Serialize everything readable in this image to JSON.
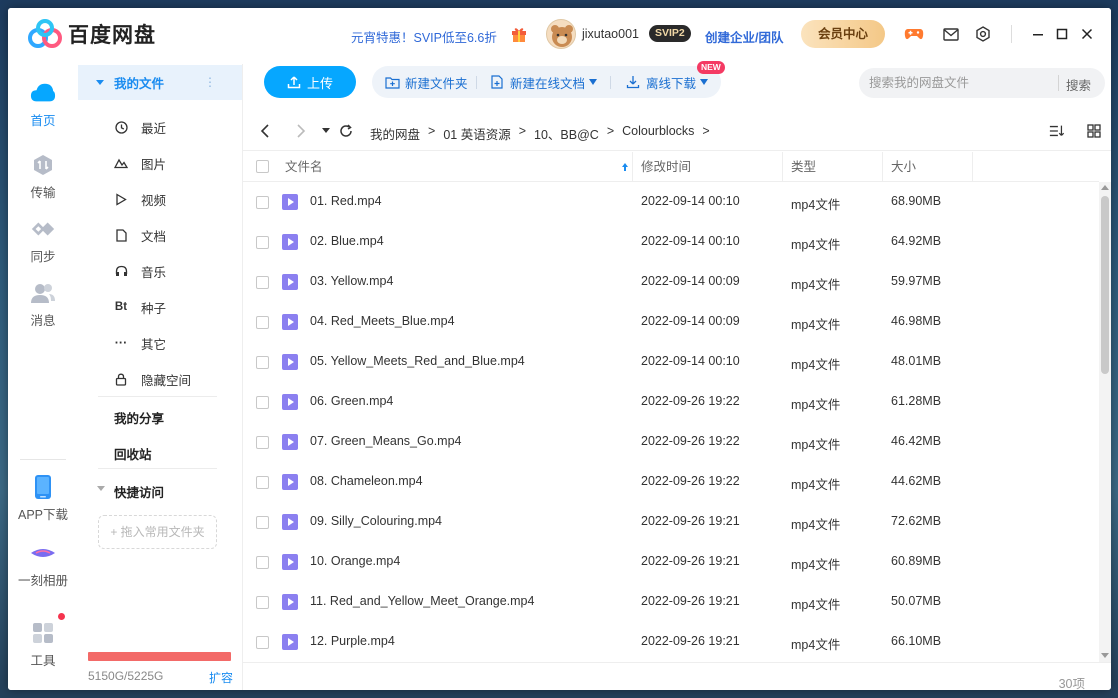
{
  "app": {
    "name": "百度网盘",
    "promo": "元宵特惠！SVIP低至6.6折",
    "username": "jixutao001",
    "badge": "SVIP2",
    "enterprise": "创建企业/团队",
    "vip_center": "会员中心"
  },
  "rail": {
    "home": "首页",
    "transfer": "传输",
    "sync": "同步",
    "messages": "消息",
    "app_download": "APP下载",
    "album": "一刻相册",
    "tools": "工具"
  },
  "sidebar": {
    "my_files": "我的文件",
    "items": [
      {
        "label": "最近",
        "icon": "clock-icon"
      },
      {
        "label": "图片",
        "icon": "image-icon"
      },
      {
        "label": "视频",
        "icon": "video-icon"
      },
      {
        "label": "文档",
        "icon": "document-icon"
      },
      {
        "label": "音乐",
        "icon": "headphones-icon"
      },
      {
        "label": "种子",
        "icon": "bt-icon"
      },
      {
        "label": "其它",
        "icon": "more-icon"
      },
      {
        "label": "隐藏空间",
        "icon": "lock-icon"
      }
    ],
    "my_share": "我的分享",
    "recycle": "回收站",
    "quick_access": "快捷访问",
    "drag_hint": "+ 拖入常用文件夹",
    "storage": "5150G/5225G",
    "storage_used_fraction": 0.9856,
    "expand": "扩容"
  },
  "toolbar": {
    "upload": "上传",
    "new_folder": "新建文件夹",
    "new_doc": "新建在线文档",
    "new_badge": "NEW",
    "offline": "离线下载",
    "search_placeholder": "搜索我的网盘文件",
    "search_button": "搜索"
  },
  "breadcrumb": [
    "我的网盘",
    "01 英语资源",
    "10、BB@C",
    "Colourblocks"
  ],
  "columns": {
    "name": "文件名",
    "modified": "修改时间",
    "type": "类型",
    "size": "大小"
  },
  "files": [
    {
      "name": "01. Red.mp4",
      "modified": "2022-09-14 00:10",
      "type": "mp4文件",
      "size": "68.90MB"
    },
    {
      "name": "02. Blue.mp4",
      "modified": "2022-09-14 00:10",
      "type": "mp4文件",
      "size": "64.92MB"
    },
    {
      "name": "03. Yellow.mp4",
      "modified": "2022-09-14 00:09",
      "type": "mp4文件",
      "size": "59.97MB"
    },
    {
      "name": "04. Red_Meets_Blue.mp4",
      "modified": "2022-09-14 00:09",
      "type": "mp4文件",
      "size": "46.98MB"
    },
    {
      "name": "05. Yellow_Meets_Red_and_Blue.mp4",
      "modified": "2022-09-14 00:10",
      "type": "mp4文件",
      "size": "48.01MB"
    },
    {
      "name": "06. Green.mp4",
      "modified": "2022-09-26 19:22",
      "type": "mp4文件",
      "size": "61.28MB"
    },
    {
      "name": "07. Green_Means_Go.mp4",
      "modified": "2022-09-26 19:22",
      "type": "mp4文件",
      "size": "46.42MB"
    },
    {
      "name": "08. Chameleon.mp4",
      "modified": "2022-09-26 19:22",
      "type": "mp4文件",
      "size": "44.62MB"
    },
    {
      "name": "09. Silly_Colouring.mp4",
      "modified": "2022-09-26 19:21",
      "type": "mp4文件",
      "size": "72.62MB"
    },
    {
      "name": "10. Orange.mp4",
      "modified": "2022-09-26 19:21",
      "type": "mp4文件",
      "size": "60.89MB"
    },
    {
      "name": "11. Red_and_Yellow_Meet_Orange.mp4",
      "modified": "2022-09-26 19:21",
      "type": "mp4文件",
      "size": "50.07MB"
    },
    {
      "name": "12. Purple.mp4",
      "modified": "2022-09-26 19:21",
      "type": "mp4文件",
      "size": "66.10MB"
    }
  ],
  "count": "30项",
  "colors": {
    "accent": "#06a7ff",
    "link": "#3069d8",
    "storage_bar": "#f36a68",
    "file_icon": "#8b7ff0"
  }
}
